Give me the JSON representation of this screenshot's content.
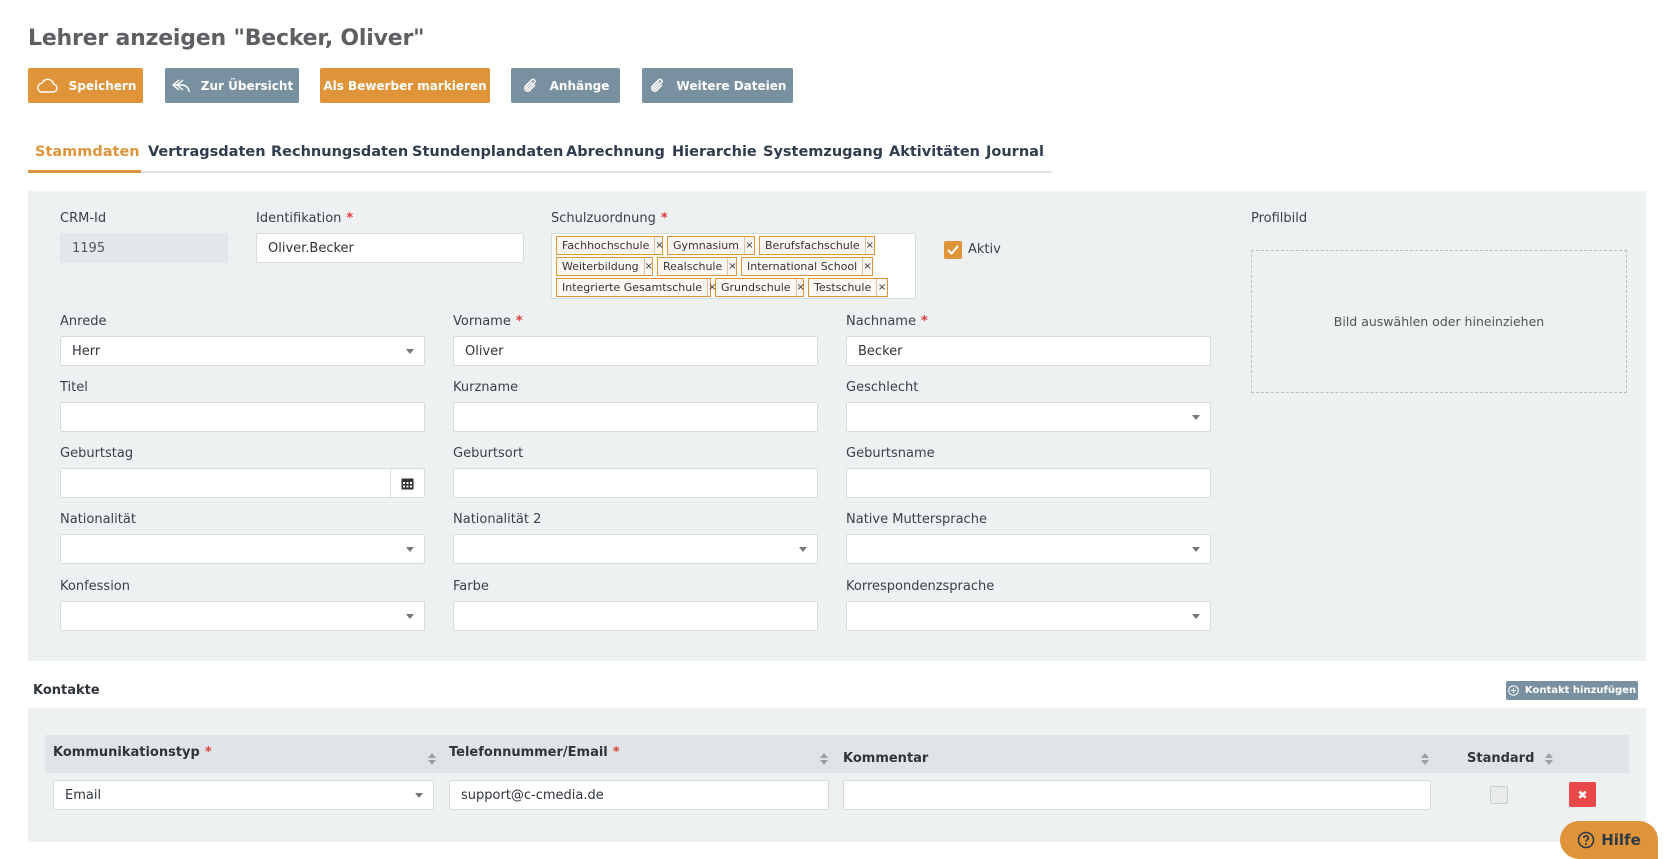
{
  "page": {
    "title": "Lehrer anzeigen \"Becker, Oliver\""
  },
  "toolbar": {
    "save_label": "Speichern",
    "overview_label": "Zur Übersicht",
    "applicant_label": "Als Bewerber markieren",
    "attachments_label": "Anhänge",
    "more_files_label": "Weitere Dateien"
  },
  "tabs": [
    {
      "label": "Stammdaten",
      "active": true
    },
    {
      "label": "Vertragsdaten"
    },
    {
      "label": "Rechnungsdaten"
    },
    {
      "label": "Stundenplandaten"
    },
    {
      "label": "Abrechnung"
    },
    {
      "label": "Hierarchie"
    },
    {
      "label": "Systemzugang"
    },
    {
      "label": "Aktivitäten"
    },
    {
      "label": "Journal"
    }
  ],
  "form": {
    "crm_id": {
      "label": "CRM-Id",
      "value": "1195"
    },
    "identifikation": {
      "label": "Identifikation",
      "value": "Oliver.Becker",
      "required": "*"
    },
    "schulzuordnung": {
      "label": "Schulzuordnung",
      "required": "*",
      "tags": [
        "Fachhochschule",
        "Gymnasium",
        "Berufsfachschule",
        "Weiterbildung",
        "Realschule",
        "International School",
        "Integrierte Gesamtschule",
        "Grundschule",
        "Testschule"
      ],
      "remove_symbol": "×"
    },
    "aktiv": {
      "label": "Aktiv",
      "checked": true
    },
    "profilbild": {
      "label": "Profilbild",
      "drop_text": "Bild auswählen oder hineinziehen"
    },
    "anrede": {
      "label": "Anrede",
      "value": "Herr"
    },
    "vorname": {
      "label": "Vorname",
      "value": "Oliver",
      "required": "*"
    },
    "nachname": {
      "label": "Nachname",
      "value": "Becker",
      "required": "*"
    },
    "titel": {
      "label": "Titel",
      "value": ""
    },
    "kurzname": {
      "label": "Kurzname",
      "value": ""
    },
    "geschlecht": {
      "label": "Geschlecht",
      "value": ""
    },
    "geburtstag": {
      "label": "Geburtstag",
      "value": ""
    },
    "geburtsort": {
      "label": "Geburtsort",
      "value": ""
    },
    "geburtsname": {
      "label": "Geburtsname",
      "value": ""
    },
    "nationalitaet": {
      "label": "Nationalität",
      "value": ""
    },
    "nationalitaet2": {
      "label": "Nationalität 2",
      "value": ""
    },
    "muttersprache": {
      "label": "Native Muttersprache",
      "value": ""
    },
    "konfession": {
      "label": "Konfession",
      "value": ""
    },
    "farbe": {
      "label": "Farbe",
      "value": ""
    },
    "korrespondenzsprache": {
      "label": "Korrespondenzsprache",
      "value": ""
    }
  },
  "contacts": {
    "title": "Kontakte",
    "add_label": "Kontakt hinzufügen",
    "columns": [
      "Kommunikationstyp",
      "Telefonnummer/Email",
      "Kommentar",
      "Standard"
    ],
    "required_mark": "*",
    "rows": [
      {
        "type": "Email",
        "value": "support@c-cmedia.de",
        "comment": "",
        "standard": false
      }
    ],
    "delete_symbol": "✖"
  },
  "help": {
    "label": "Hilfe"
  },
  "colors": {
    "accent": "#df943a",
    "secondary": "#7890a0",
    "danger": "#e84848",
    "panel": "#edf1f2"
  }
}
